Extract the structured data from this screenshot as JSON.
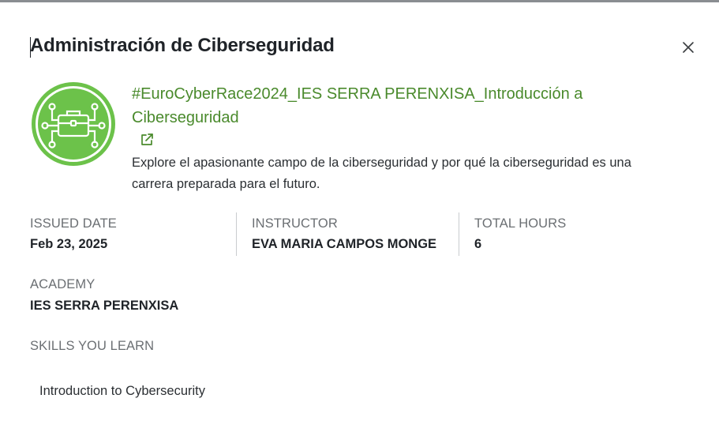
{
  "modal": {
    "title": "Administración de Ciberseguridad",
    "close_icon": "close-icon"
  },
  "course": {
    "badge_icon": "cybersecurity-briefcase-network-icon",
    "title_line1": "#EuroCyberRace2024_IES SERRA PERENXISA_Introducción a",
    "title_line2": "Ciberseguridad",
    "external_link_icon": "external-link-icon",
    "description_line1": "Explore el apasionante campo de la ciberseguridad y por qué la ciberseguridad es una",
    "description_line2": "carrera preparada para el futuro."
  },
  "details": {
    "issued_date_label": "ISSUED DATE",
    "issued_date_value": "Feb 23, 2025",
    "instructor_label": "INSTRUCTOR",
    "instructor_value": "EVA MARIA CAMPOS MONGE",
    "total_hours_label": "TOTAL HOURS",
    "total_hours_value": "6",
    "academy_label": "ACADEMY",
    "academy_value": "IES SERRA PERENXISA",
    "skills_label": "SKILLS YOU LEARN",
    "skills": [
      "Introduction to Cybersecurity"
    ]
  },
  "colors": {
    "accent_green": "#4a8a2c",
    "badge_green": "#6cc24a",
    "text": "#1f2328",
    "muted": "#6b6f73"
  }
}
